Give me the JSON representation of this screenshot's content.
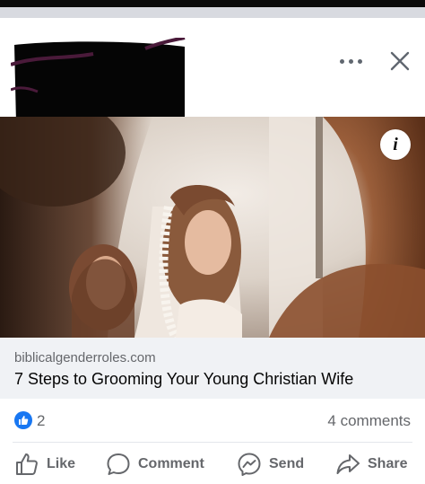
{
  "header": {
    "more_icon": "ellipsis-icon",
    "close_icon": "close-icon"
  },
  "link_preview": {
    "info_glyph": "i",
    "domain": "biblicalgenderroles.com",
    "title": "7 Steps to Grooming Your Young Christian Wife"
  },
  "stats": {
    "reaction_count": "2",
    "comments": "4 comments",
    "reaction_color": "#1877f2"
  },
  "actions": {
    "like": "Like",
    "comment": "Comment",
    "send": "Send",
    "share": "Share"
  }
}
